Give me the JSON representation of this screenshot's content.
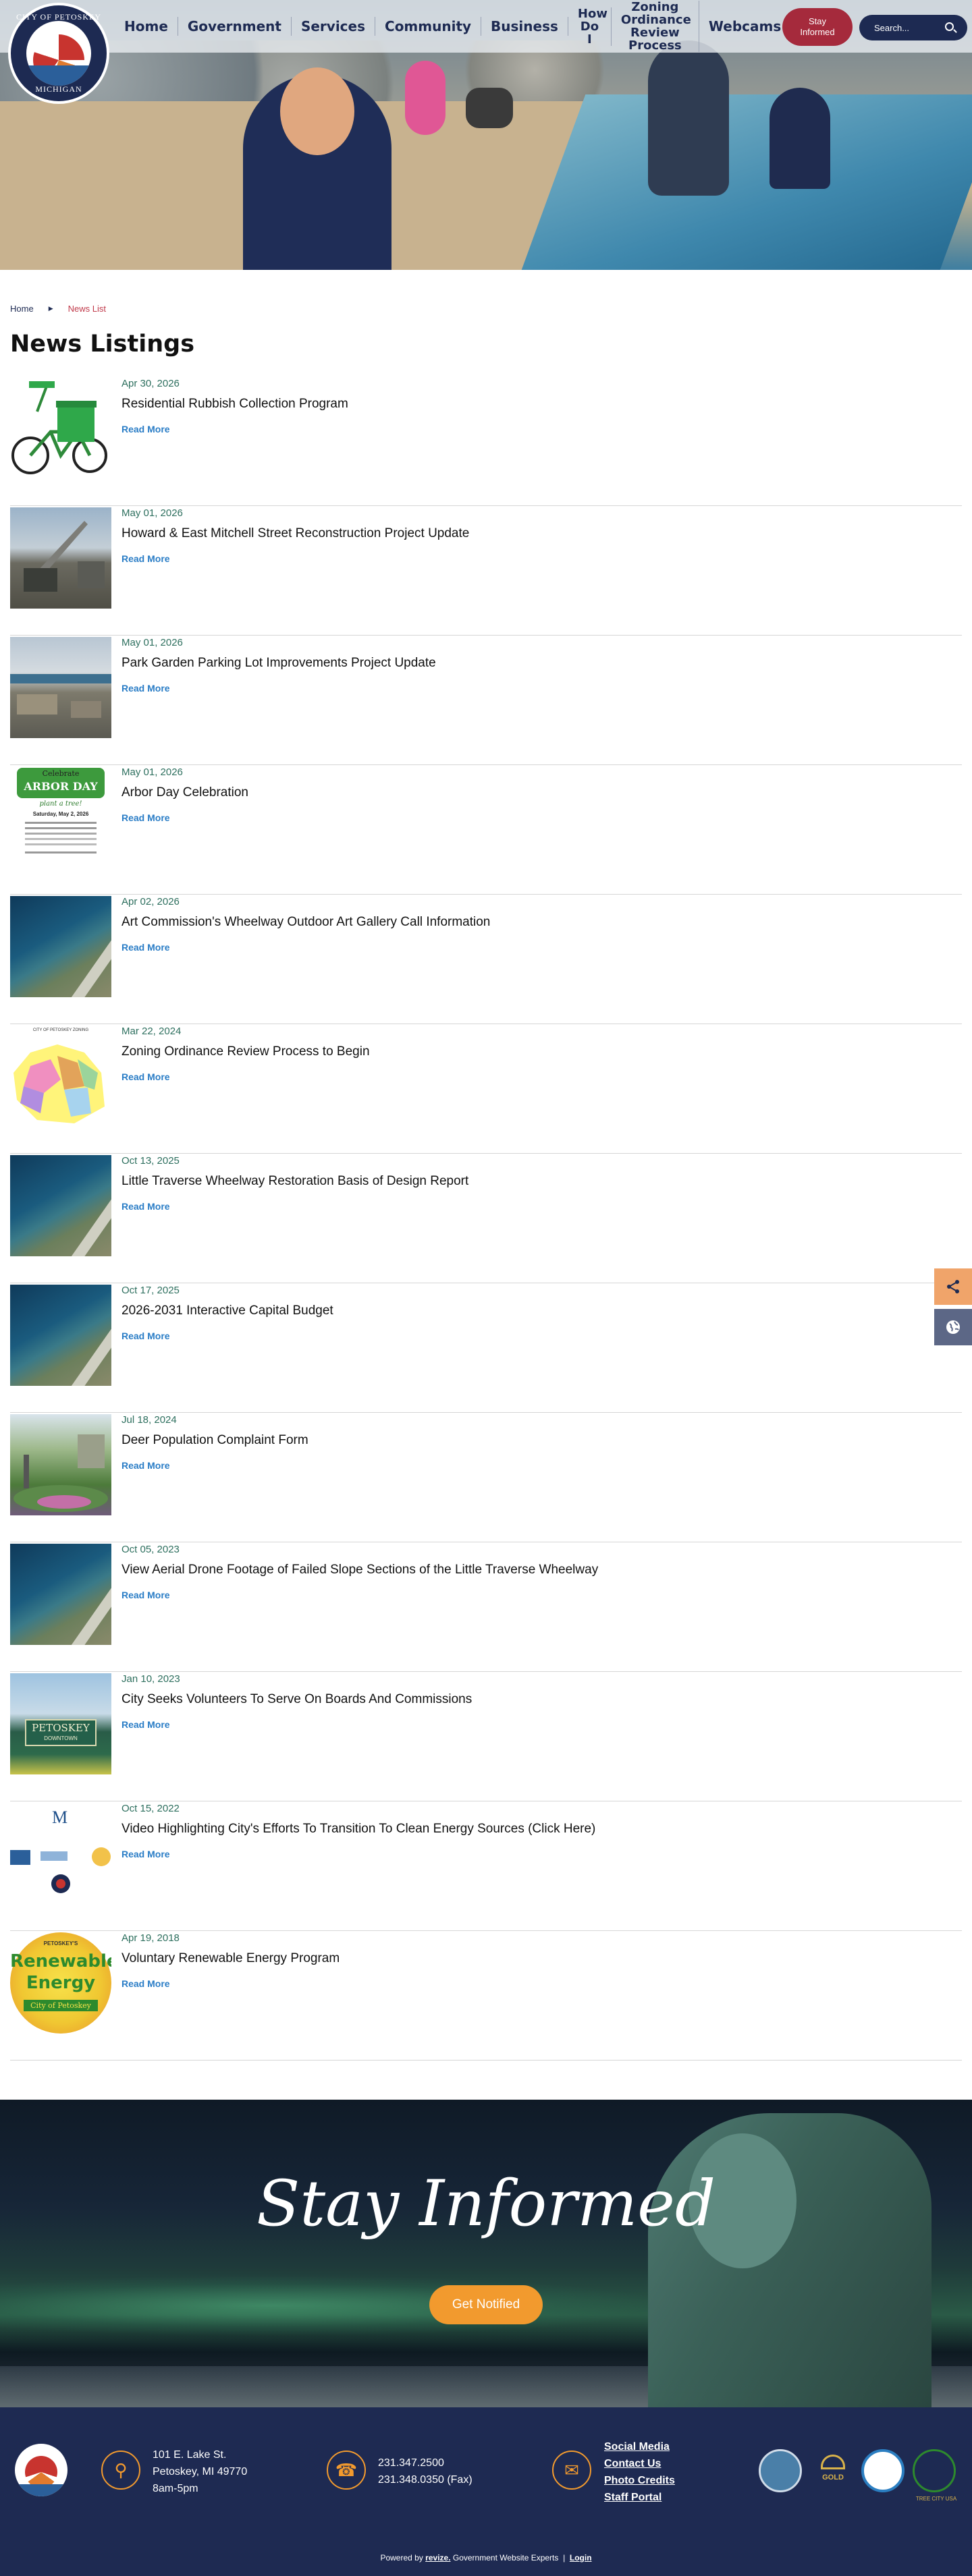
{
  "logo": {
    "top_text": "CITY OF PETOSKEY",
    "bottom_text": "MICHIGAN"
  },
  "nav": {
    "items": [
      "Home",
      "Government",
      "Services",
      "Community",
      "Business",
      "How Do I",
      "Zoning Ordinance Review Process",
      "Webcams"
    ],
    "stay_informed": "Stay Informed",
    "search_placeholder": "Search..."
  },
  "breadcrumb": {
    "home": "Home",
    "current": "News List"
  },
  "page_title": "News Listings",
  "news": [
    {
      "date": "Apr 30, 2026",
      "title": "Residential Rubbish Collection Program",
      "more": "Read More",
      "thumb": "bike-icon"
    },
    {
      "date": "May 01, 2026",
      "title": "Howard & East Mitchell Street Reconstruction Project Update",
      "more": "Read More",
      "thumb": "construction"
    },
    {
      "date": "May 01, 2026",
      "title": "Park Garden Parking Lot Improvements Project Update",
      "more": "Read More",
      "thumb": "parking"
    },
    {
      "date": "May 01, 2026",
      "title": "Arbor Day Celebration",
      "more": "Read More",
      "thumb": "arbor-day-flyer"
    },
    {
      "date": "Apr 02, 2026",
      "title": "Art Commission's Wheelway Outdoor Art Gallery Call Information",
      "more": "Read More",
      "thumb": "aerial"
    },
    {
      "date": "Mar 22, 2024",
      "title": "Zoning Ordinance Review Process to Begin",
      "more": "Read More",
      "thumb": "zoning-map"
    },
    {
      "date": "Oct 13, 2025",
      "title": "Little Traverse Wheelway Restoration Basis of Design Report",
      "more": "Read More",
      "thumb": "aerial"
    },
    {
      "date": "Oct 17, 2025",
      "title": "2026-2031 Interactive Capital Budget",
      "more": "Read More",
      "thumb": "aerial"
    },
    {
      "date": "Jul 18, 2024",
      "title": "Deer Population Complaint Form",
      "more": "Read More",
      "thumb": "deer"
    },
    {
      "date": "Oct 05, 2023",
      "title": "View Aerial Drone Footage of Failed Slope Sections of the Little Traverse Wheelway",
      "more": "Read More",
      "thumb": "aerial"
    },
    {
      "date": "Jan 10, 2023",
      "title": "City Seeks Volunteers To Serve On Boards And Commissions",
      "more": "Read More",
      "thumb": "petoskey-sign"
    },
    {
      "date": "Oct 15, 2022",
      "title": "Video Highlighting City's Efforts To Transition To Clean Energy Sources (Click Here)",
      "more": "Read More",
      "thumb": "clean-energy-logos"
    },
    {
      "date": "Apr 19, 2018",
      "title": "Voluntary Renewable Energy Program",
      "more": "Read More",
      "thumb": "renewable-energy"
    }
  ],
  "thumb_text": {
    "arbor_line1": "Celebrate",
    "arbor_line2": "ARBOR DAY",
    "arbor_line3": "plant a tree!",
    "arbor_line4": "Saturday, May 2, 2026",
    "zoning_header": "CITY OF PETOSKEY ZONING",
    "energy_top": "PETOSKEY'S",
    "energy_line1": "Renewable",
    "energy_line2": "Energy",
    "energy_line3": "City of Petoskey",
    "sign_text": "PETOSKEY",
    "sign_sub": "DOWNTOWN"
  },
  "promo": {
    "heading": "Stay Informed",
    "button": "Get Notified"
  },
  "footer": {
    "address_line1": "101 E. Lake St.",
    "address_line2": "Petoskey, MI 49770",
    "hours": "8am-5pm",
    "phone": "231.347.2500",
    "fax": "231.348.0350 (Fax)",
    "links": [
      "Social Media",
      "Contact Us",
      "Photo Credits",
      "Staff Portal"
    ],
    "badge_gold": "GOLD",
    "badge_tree": "TREE CITY USA",
    "powered_prefix": "Powered by",
    "powered_brand": "revize.",
    "powered_suffix": "Government Website Experts",
    "login": "Login"
  },
  "colors": {
    "navy": "#1d2a52",
    "accent_orange": "#f29a2e",
    "stay_red": "#a52a3c",
    "link_blue": "#2a7dc6",
    "date_green": "#2d6f5e"
  }
}
